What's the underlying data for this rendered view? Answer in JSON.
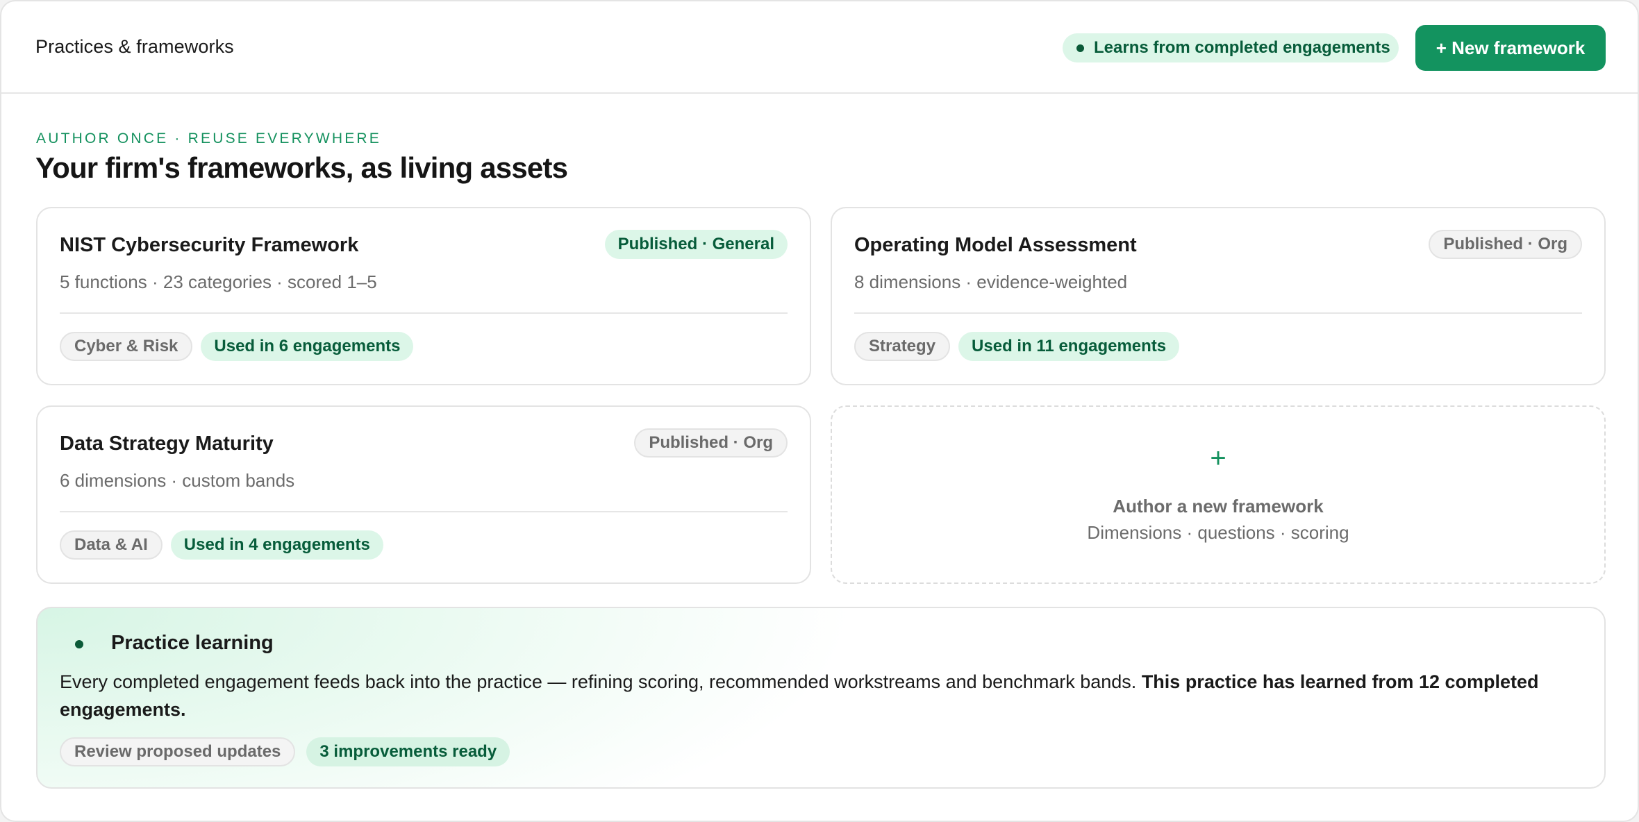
{
  "header": {
    "title": "Practices & frameworks",
    "learning_badge": "Learns from completed engagements",
    "new_button": "+ New framework"
  },
  "hero": {
    "eyebrow": "AUTHOR ONCE · REUSE EVERYWHERE",
    "title": "Your firm's frameworks, as living assets"
  },
  "frameworks": [
    {
      "name": "NIST Cybersecurity Framework",
      "status": "Published · General",
      "meta": "5 functions · 23 categories · scored 1–5",
      "practice": "Cyber & Risk",
      "usage": "Used in 6 engagements"
    },
    {
      "name": "Operating Model Assessment",
      "status": "Published · Org",
      "meta": "8 dimensions · evidence-weighted",
      "practice": "Strategy",
      "usage": "Used in 11 engagements"
    },
    {
      "name": "Data Strategy Maturity",
      "status": "Published · Org",
      "meta": "6 dimensions · custom bands",
      "practice": "Data & AI",
      "usage": "Used in 4 engagements"
    }
  ],
  "add_card": {
    "plus": "+",
    "title": "Author a new framework",
    "subtitle": "Dimensions · questions · scoring"
  },
  "learning": {
    "title": "Practice learning",
    "body": "Every completed engagement feeds back into the practice — refining scoring, recommended workstreams and benchmark bands. ",
    "body_strong": "This practice has learned from 12 completed engagements.",
    "review_button": "Review proposed updates",
    "improvements": "3 improvements ready"
  },
  "colors": {
    "accent": "#13935f",
    "accent_text": "#075c3a",
    "accent_soft": "#dcf6e8"
  }
}
